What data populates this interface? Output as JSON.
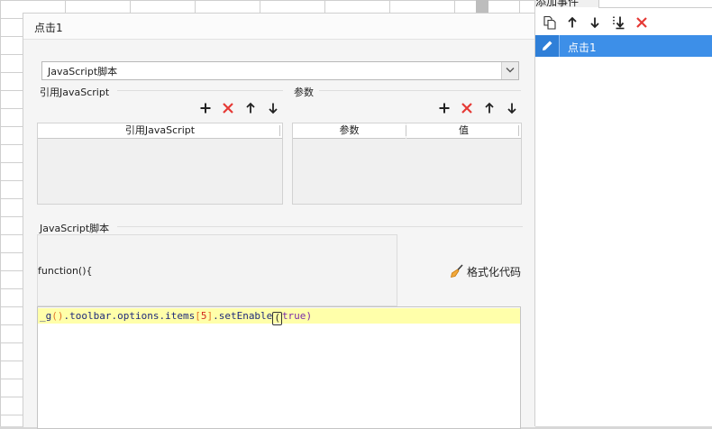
{
  "dialog": {
    "title": "点击1",
    "script_type": "JavaScript脚本",
    "ref_section_label": "引用JavaScript",
    "params_section_label": "参数",
    "ref_table": {
      "columns": [
        "引用JavaScript"
      ]
    },
    "params_table": {
      "columns": [
        "参数",
        "值"
      ]
    },
    "script_section_label": "JavaScript脚本",
    "function_header": "function(){",
    "format_button_label": "格式化代码",
    "code_tokens": [
      "_g",
      "()",
      ".toolbar.options.items",
      "[",
      "5",
      "]",
      ".setEnable",
      "(",
      "true",
      ")"
    ]
  },
  "right_panel": {
    "top_label": "添加事件",
    "event_items": [
      "点击1"
    ]
  },
  "colors": {
    "accent": "#3d8fe8",
    "delete_red": "#e53935",
    "code_highlight": "#ffffaa"
  },
  "icons": [
    "plus-icon",
    "delete-icon",
    "arrow-up-icon",
    "arrow-down-icon",
    "copy-icon",
    "move-bottom-icon",
    "pencil-icon",
    "broom-icon",
    "chevron-down-icon"
  ]
}
